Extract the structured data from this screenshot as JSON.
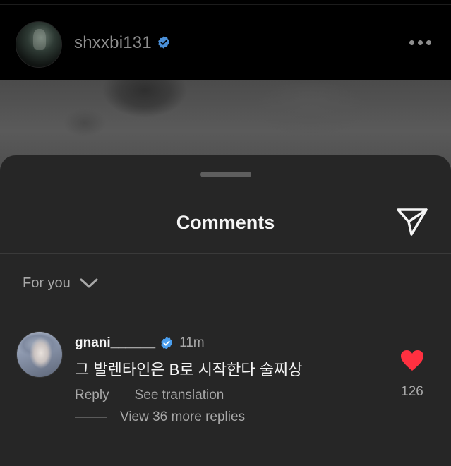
{
  "post": {
    "username": "shxxbi131",
    "verified_icon": "verified-badge-icon",
    "more_icon": "more-options-icon"
  },
  "sheet": {
    "title": "Comments",
    "share_icon": "send-icon",
    "filter_label": "For you",
    "filter_icon": "chevron-down-icon"
  },
  "comment": {
    "username": "gnani______",
    "time": "11m",
    "text": "그 발렌타인은 B로 시작한다 술찌상",
    "reply_label": "Reply",
    "translate_label": "See translation",
    "likes": "126",
    "heart_color": "#ff3040",
    "verified_color": "#0095f6",
    "view_replies_label": "View 36 more replies"
  }
}
